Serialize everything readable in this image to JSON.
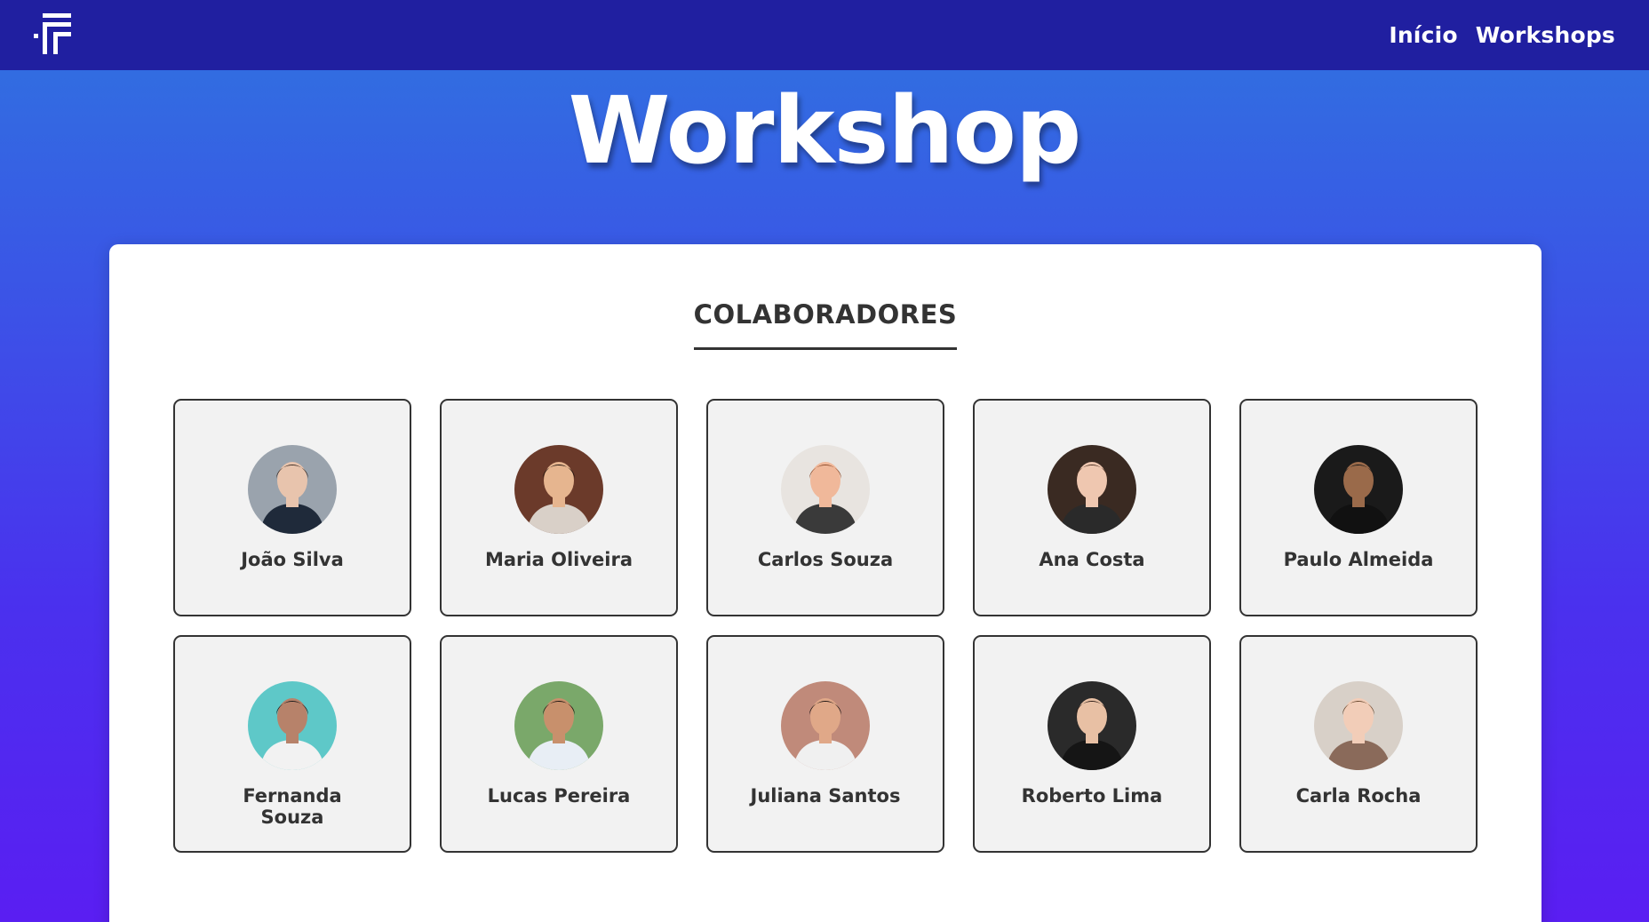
{
  "nav": {
    "logo_icon": "brand-logo-icon",
    "links": [
      "Início",
      "Workshops"
    ]
  },
  "hero": {
    "title": "Workshop"
  },
  "section": {
    "title": "COLABORADORES"
  },
  "collaborators": [
    {
      "name": "João Silva",
      "icon": "avatar-photo",
      "bg": "#9aa3ad",
      "skin": "#e8c4ad",
      "hair": "#3a2a22",
      "shirt": "#1f2a3a"
    },
    {
      "name": "Maria Oliveira",
      "icon": "avatar-photo",
      "bg": "#6b3a2a",
      "skin": "#e6b58f",
      "hair": "#1e120d",
      "shirt": "#d9d0c8"
    },
    {
      "name": "Carlos Souza",
      "icon": "avatar-photo",
      "bg": "#e8e4e0",
      "skin": "#f0b89a",
      "hair": "#8a4a2a",
      "shirt": "#3a3a3a"
    },
    {
      "name": "Ana Costa",
      "icon": "avatar-photo",
      "bg": "#3a2a22",
      "skin": "#efc7b0",
      "hair": "#4a2e20",
      "shirt": "#2a2a2a"
    },
    {
      "name": "Paulo Almeida",
      "icon": "avatar-photo",
      "bg": "#1a1a1a",
      "skin": "#9a6a4a",
      "hair": "#1a1a1a",
      "shirt": "#111111"
    },
    {
      "name": "Fernanda Souza",
      "icon": "avatar-photo",
      "bg": "#5ec8c8",
      "skin": "#b7826a",
      "hair": "#1b1b1b",
      "shirt": "#f2f2f2"
    },
    {
      "name": "Lucas Pereira",
      "icon": "avatar-photo",
      "bg": "#7aa86a",
      "skin": "#c8906c",
      "hair": "#1e1410",
      "shirt": "#e8eef5"
    },
    {
      "name": "Juliana Santos",
      "icon": "avatar-photo",
      "bg": "#c08a7a",
      "skin": "#e0a888",
      "hair": "#1a1210",
      "shirt": "#f0f0f0"
    },
    {
      "name": "Roberto Lima",
      "icon": "avatar-photo",
      "bg": "#2a2a2a",
      "skin": "#e8c0a4",
      "hair": "#2a1a14",
      "shirt": "#151515"
    },
    {
      "name": "Carla Rocha",
      "icon": "avatar-photo",
      "bg": "#d8d0c8",
      "skin": "#f2cdb8",
      "hair": "#6a4a30",
      "shirt": "#8a6a5a"
    }
  ]
}
